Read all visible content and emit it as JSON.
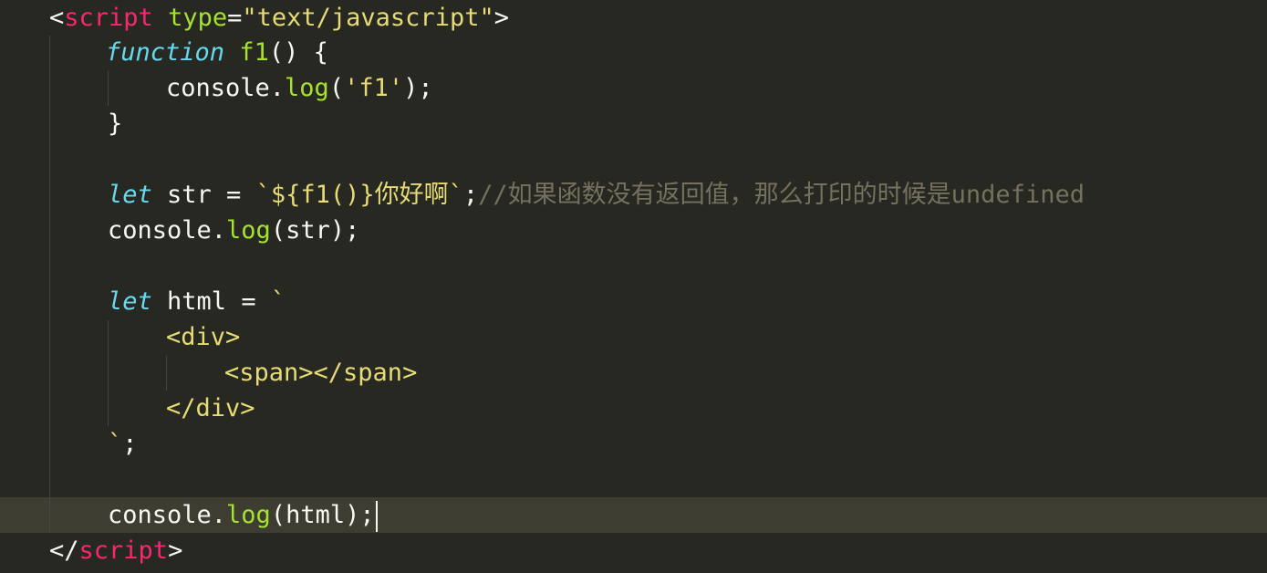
{
  "colors": {
    "background": "#272822",
    "active_line": "#3e3d32",
    "plain": "#f8f8f2",
    "tag": "#f92672",
    "attribute": "#a6e22e",
    "string": "#e6db74",
    "keyword_storage": "#66d9ef",
    "function_name": "#a6e22e",
    "comment": "#75715e",
    "indent_guide": "#464741"
  },
  "lines": [
    {
      "tokens": [
        {
          "text": "<",
          "cls": "plain"
        },
        {
          "text": "script",
          "cls": "tag"
        },
        {
          "text": " ",
          "cls": "plain"
        },
        {
          "text": "type",
          "cls": "attribute"
        },
        {
          "text": "=",
          "cls": "plain"
        },
        {
          "text": "\"text/javascript\"",
          "cls": "string"
        },
        {
          "text": ">",
          "cls": "plain"
        }
      ]
    },
    {
      "tokens": [
        {
          "text": "function",
          "cls": "keyword_italic"
        },
        {
          "text": " ",
          "cls": "plain"
        },
        {
          "text": "f1",
          "cls": "function_name"
        },
        {
          "text": "() {",
          "cls": "plain"
        }
      ]
    },
    {
      "tokens": [
        {
          "text": "console.",
          "cls": "plain"
        },
        {
          "text": "log",
          "cls": "function_name"
        },
        {
          "text": "(",
          "cls": "plain"
        },
        {
          "text": "'f1'",
          "cls": "string"
        },
        {
          "text": ");",
          "cls": "plain"
        }
      ]
    },
    {
      "tokens": [
        {
          "text": "}",
          "cls": "plain"
        }
      ]
    },
    {
      "tokens": []
    },
    {
      "tokens": [
        {
          "text": "let",
          "cls": "keyword_italic"
        },
        {
          "text": " str = ",
          "cls": "plain"
        },
        {
          "text": "`${f1()}你好啊`",
          "cls": "string"
        },
        {
          "text": ";",
          "cls": "plain"
        },
        {
          "text": "//如果函数没有返回值，那么打印的时候是undefined",
          "cls": "comment"
        }
      ]
    },
    {
      "tokens": [
        {
          "text": "console.",
          "cls": "plain"
        },
        {
          "text": "log",
          "cls": "function_name"
        },
        {
          "text": "(str);",
          "cls": "plain"
        }
      ]
    },
    {
      "tokens": []
    },
    {
      "tokens": [
        {
          "text": "let",
          "cls": "keyword_italic"
        },
        {
          "text": " html = ",
          "cls": "plain"
        },
        {
          "text": "`",
          "cls": "string"
        }
      ]
    },
    {
      "tokens": [
        {
          "text": "<div>",
          "cls": "string"
        }
      ]
    },
    {
      "tokens": [
        {
          "text": "<span></span>",
          "cls": "string"
        }
      ]
    },
    {
      "tokens": [
        {
          "text": "</div>",
          "cls": "string"
        }
      ]
    },
    {
      "tokens": [
        {
          "text": "`",
          "cls": "string"
        },
        {
          "text": ";",
          "cls": "plain"
        }
      ]
    },
    {
      "tokens": []
    },
    {
      "tokens": [
        {
          "text": "console.",
          "cls": "plain"
        },
        {
          "text": "log",
          "cls": "function_name"
        },
        {
          "text": "(html);",
          "cls": "plain"
        }
      ]
    },
    {
      "tokens": [
        {
          "text": "</",
          "cls": "plain"
        },
        {
          "text": "script",
          "cls": "tag"
        },
        {
          "text": ">",
          "cls": "plain"
        }
      ]
    }
  ]
}
